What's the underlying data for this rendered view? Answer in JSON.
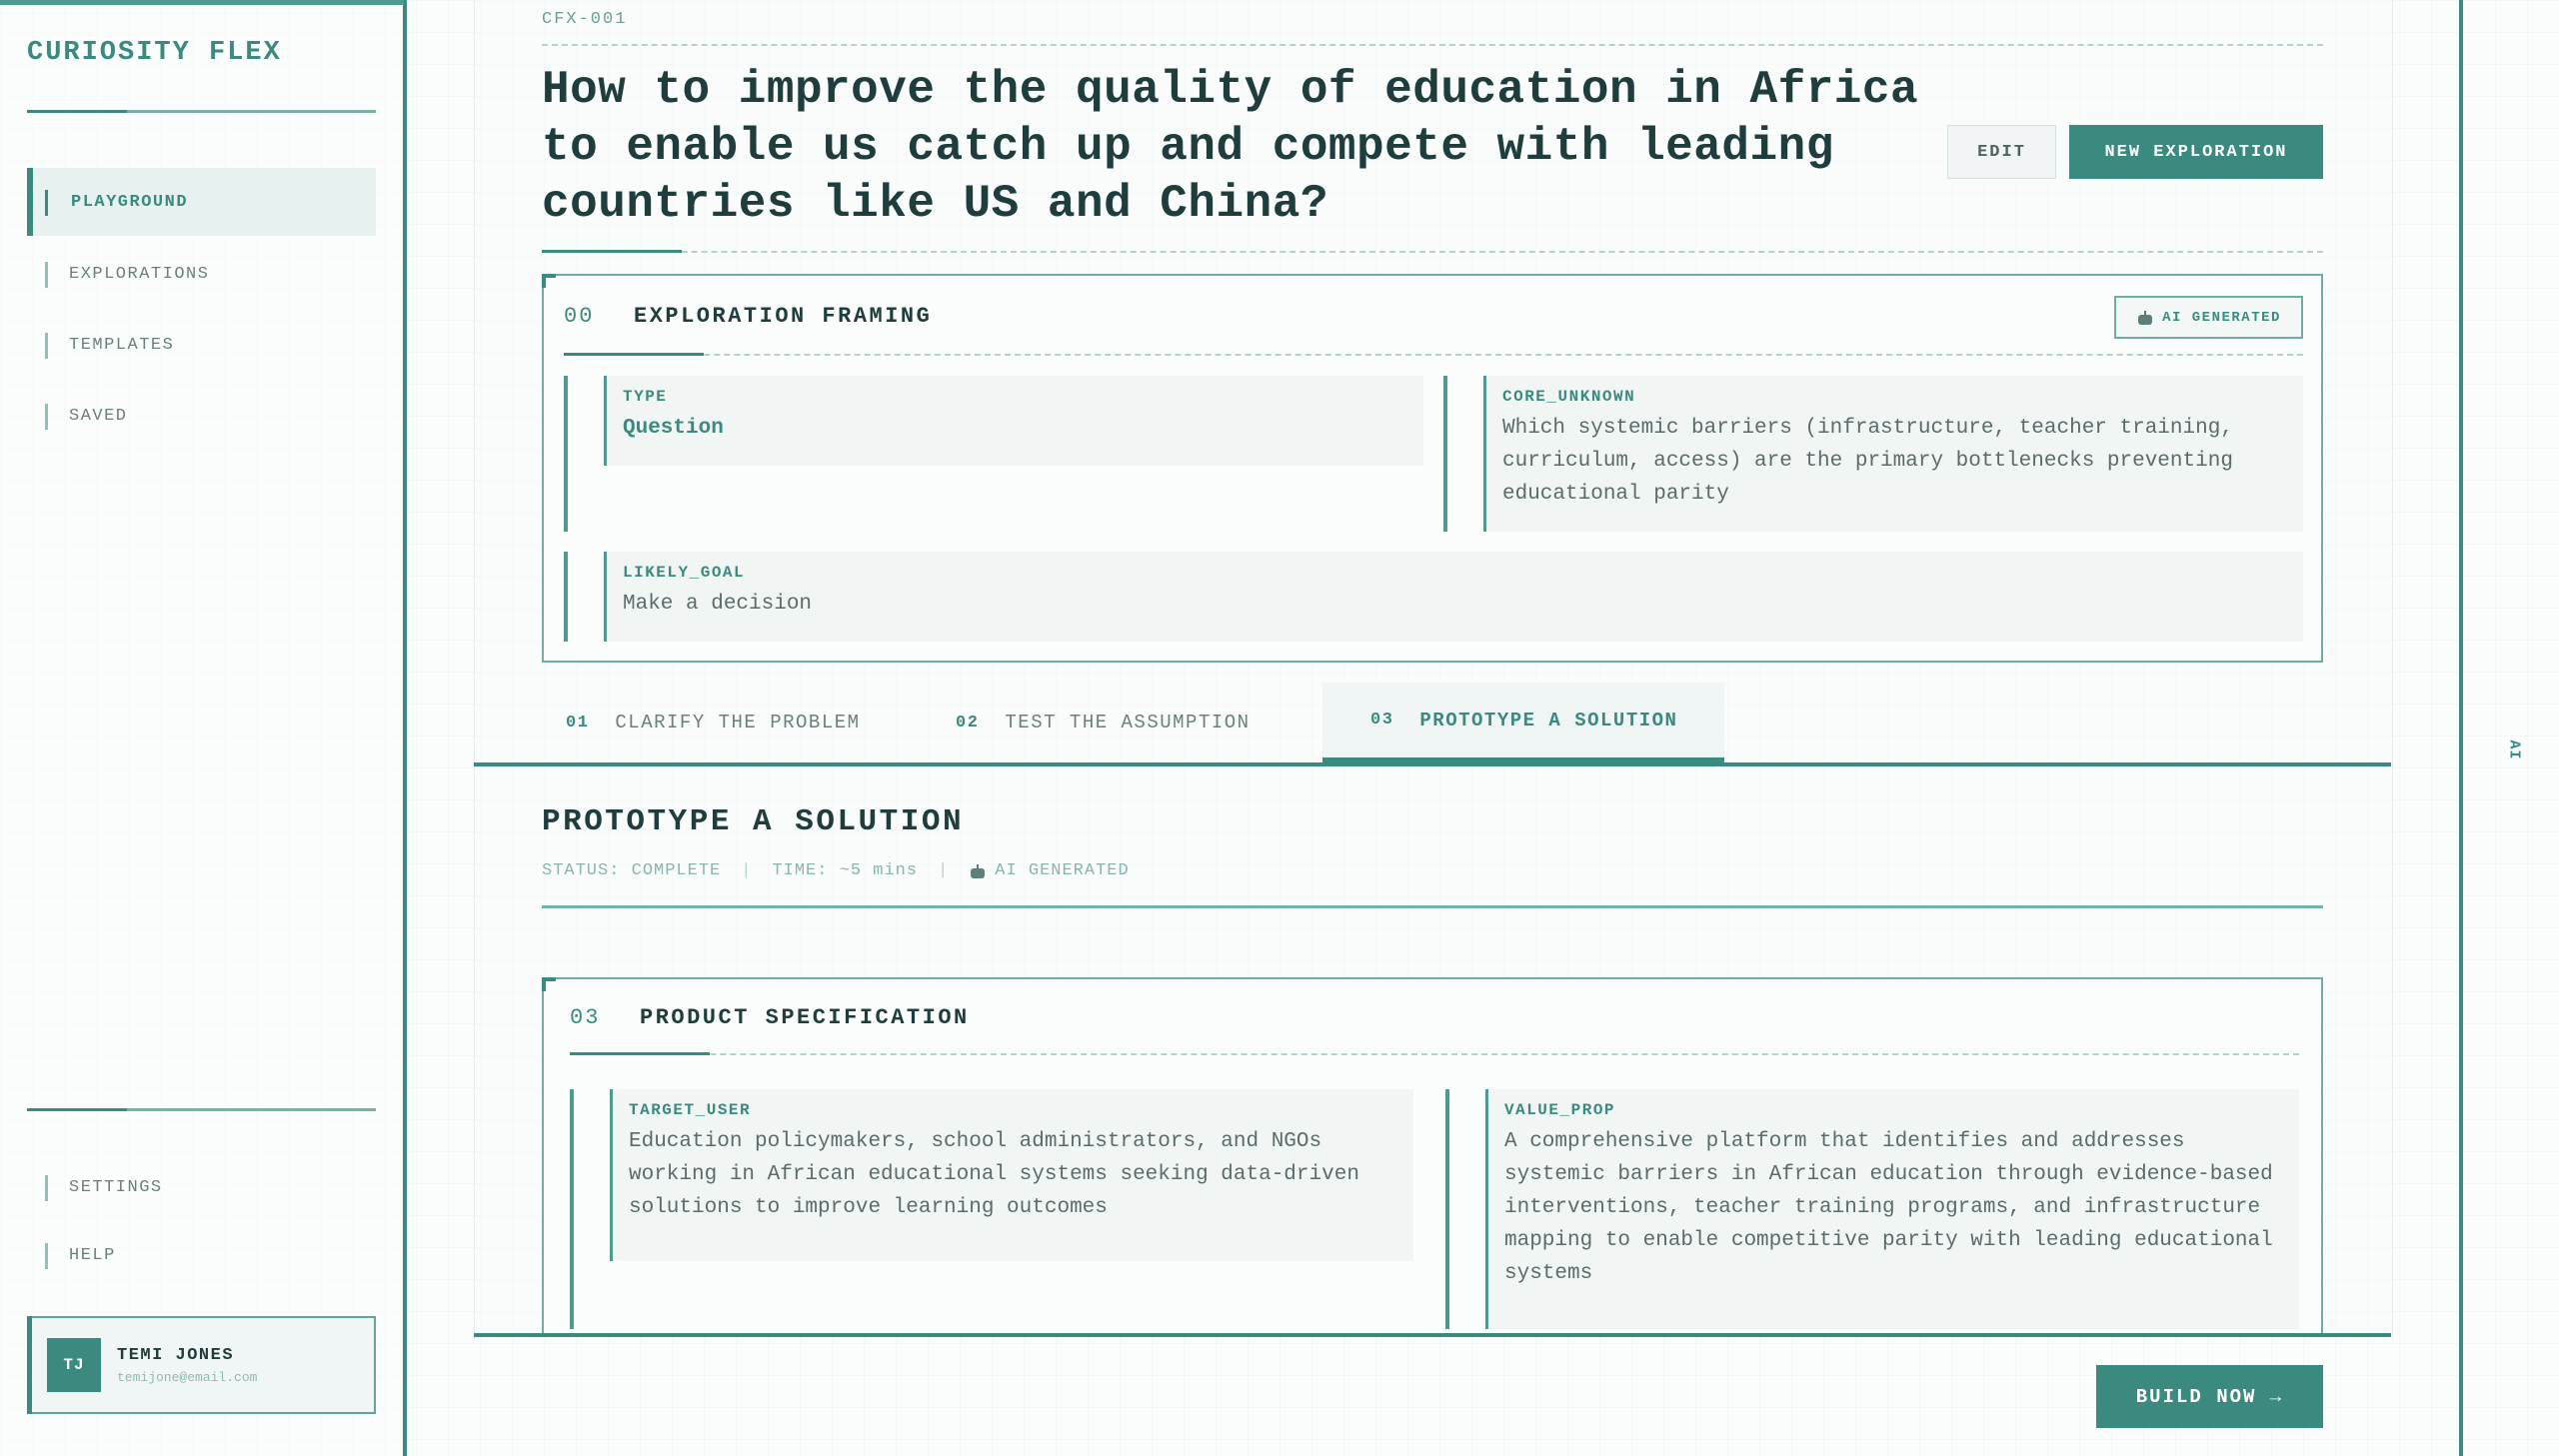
{
  "app": {
    "name": "CURIOSITY FLEX"
  },
  "sidebar": {
    "nav": [
      {
        "label": "PLAYGROUND",
        "active": true
      },
      {
        "label": "EXPLORATIONS",
        "active": false
      },
      {
        "label": "TEMPLATES",
        "active": false
      },
      {
        "label": "SAVED",
        "active": false
      }
    ],
    "bottom_nav": [
      {
        "label": "SETTINGS"
      },
      {
        "label": "HELP"
      }
    ],
    "user": {
      "initials": "TJ",
      "name": "TEMI JONES",
      "email": "temijone@email.com"
    }
  },
  "header": {
    "id": "CFX-001",
    "title": "How to improve the quality of education in Africa to enable us catch up and compete with leading countries like US and China?",
    "edit_label": "EDIT",
    "new_label": "NEW EXPLORATION"
  },
  "framing": {
    "num": "00",
    "title": "EXPLORATION FRAMING",
    "badge": "AI GENERATED",
    "type_label": "TYPE",
    "type_value": "Question",
    "core_label": "CORE_UNKNOWN",
    "core_value": "Which systemic barriers (infrastructure, teacher training, curriculum, access) are the primary bottlenecks preventing educational parity",
    "goal_label": "LIKELY_GOAL",
    "goal_value": "Make a decision"
  },
  "tabs": [
    {
      "num": "01",
      "label": "CLARIFY THE PROBLEM",
      "active": false
    },
    {
      "num": "02",
      "label": "TEST THE ASSUMPTION",
      "active": false
    },
    {
      "num": "03",
      "label": "PROTOTYPE A SOLUTION",
      "active": true
    }
  ],
  "section": {
    "title": "PROTOTYPE A SOLUTION",
    "status": "STATUS: COMPLETE",
    "time": "TIME: ~5 mins",
    "ai": "AI GENERATED",
    "separator": "|"
  },
  "spec": {
    "num": "03",
    "title": "PRODUCT SPECIFICATION",
    "target_label": "TARGET_USER",
    "target_value": "Education policymakers, school administrators, and NGOs working in African educational systems seeking data-driven solutions to improve learning outcomes",
    "value_label": "VALUE_PROP",
    "value_value": "A comprehensive platform that identifies and addresses systemic barriers in African education through evidence-based interventions, teacher training programs, and infrastructure mapping to enable competitive parity with leading educational systems"
  },
  "build_label": "BUILD NOW →",
  "right_rail_label": "AI",
  "colors": {
    "accent": "#3a8a80",
    "ink": "#1f3d3d",
    "muted": "#6b7f7f"
  }
}
